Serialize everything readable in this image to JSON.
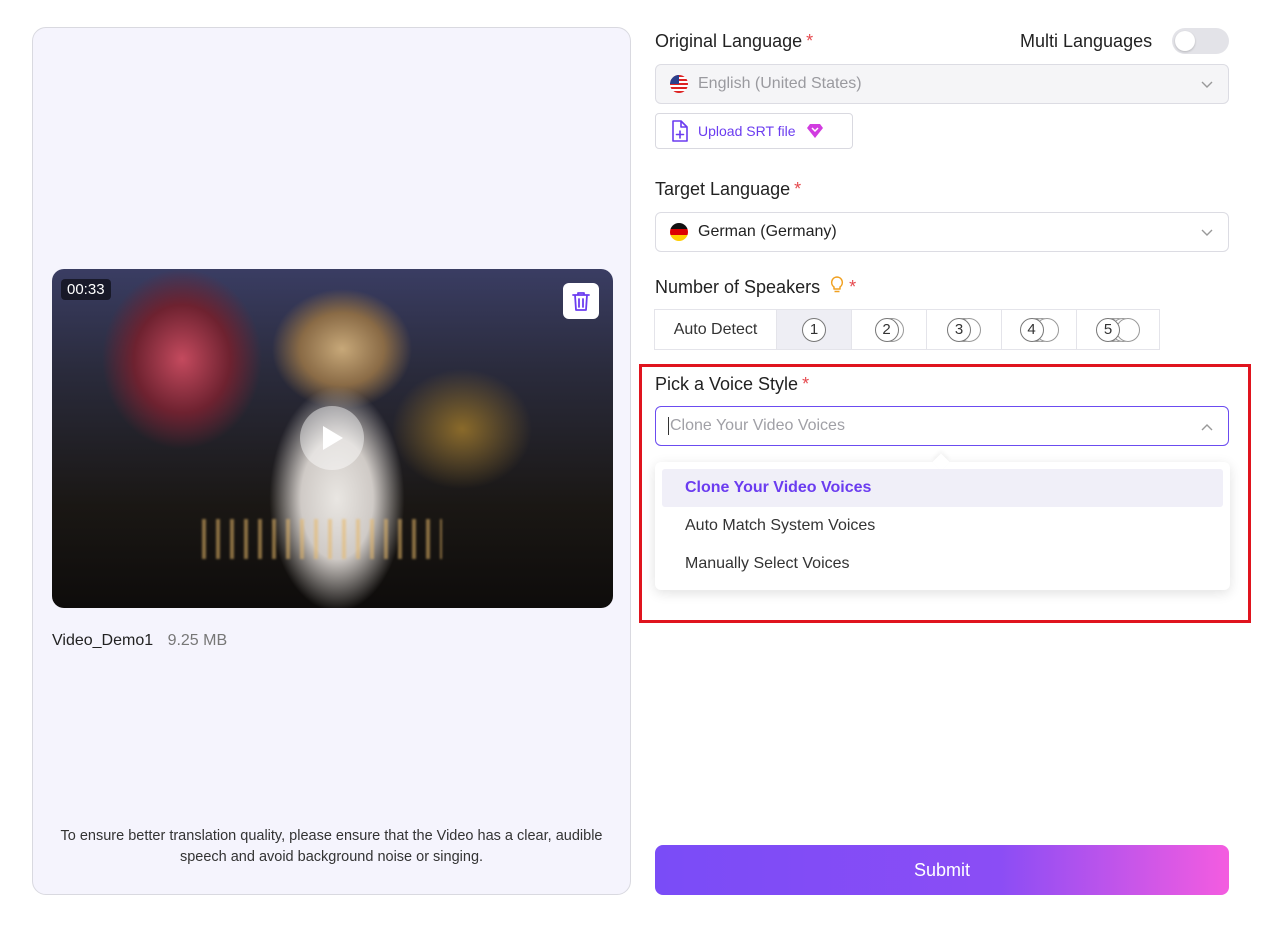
{
  "video": {
    "duration": "00:33",
    "file_name": "Video_Demo1",
    "file_size": "9.25 MB"
  },
  "hint": "To ensure better translation quality, please ensure that the Video has a clear, audible speech and avoid background noise or singing.",
  "original_language": {
    "label": "Original Language",
    "required": "*",
    "value": "English (United States)",
    "multi_label": "Multi Languages",
    "multi_enabled": false
  },
  "upload": {
    "label": "Upload SRT file"
  },
  "target_language": {
    "label": "Target Language",
    "required": "*",
    "value": "German (Germany)"
  },
  "speakers": {
    "label": "Number of Speakers",
    "required": "*",
    "auto_label": "Auto Detect",
    "options": [
      "1",
      "2",
      "3",
      "4",
      "5"
    ],
    "selected": "1"
  },
  "voice_style": {
    "label": "Pick a Voice Style",
    "required": "*",
    "placeholder": "Clone Your Video Voices",
    "options": [
      "Clone Your Video Voices",
      "Auto Match System Voices",
      "Manually Select Voices"
    ],
    "active_option": "Clone Your Video Voices"
  },
  "submit_label": "Submit",
  "colors": {
    "accent": "#6b3cf0",
    "required": "#e5484d",
    "highlight": "#e0141e"
  }
}
